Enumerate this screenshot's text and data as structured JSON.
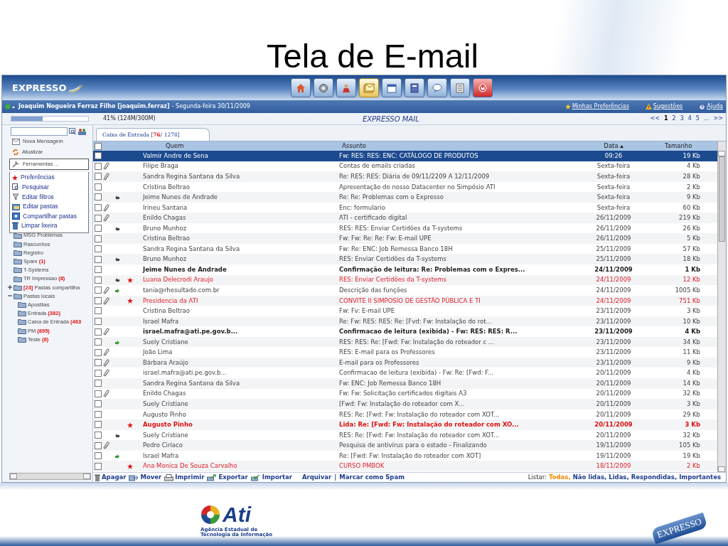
{
  "slide": {
    "title": "Tela de E-mail",
    "footer_logo": {
      "text": "Ati",
      "caption": "Agência Estadual de Tecnologia da Informação"
    },
    "footer_product": "EXPRESSO"
  },
  "app": {
    "logo": "EXPRESSO",
    "toolbar": [
      {
        "selected": false
      },
      {
        "selected": false
      },
      {
        "selected": false
      },
      {
        "selected": true
      },
      {
        "selected": false
      },
      {
        "selected": false
      },
      {
        "selected": false
      },
      {
        "selected": false
      },
      {
        "selected": false
      }
    ],
    "user": "Joaquim Nogueira Ferraz Filho [joaquim.ferraz]",
    "date": "- Segunda-feira 30/11/2009",
    "top_links": [
      "Minhas Preferências",
      "Sugestões",
      "Ajuda"
    ],
    "quota": {
      "level": 0.41,
      "reading": "41% (124M/300M)"
    },
    "module_title": "EXPRESSO MAIL",
    "pagination": [
      {
        "label": "<<",
        "selected": false
      },
      {
        "label": "1",
        "selected": true
      },
      {
        "label": "2",
        "selected": false
      },
      {
        "label": "3",
        "selected": false
      },
      {
        "label": "4",
        "selected": false
      },
      {
        "label": "5",
        "selected": false
      },
      {
        "label": "...",
        "selected": false
      },
      {
        "label": ">>",
        "selected": false
      }
    ],
    "sidebar": {
      "actions": [
        {
          "label": "Nova Mensagem"
        },
        {
          "label": "Atualizar"
        },
        {
          "label": "Ferramentas ...",
          "expanded": true,
          "menu": [
            "Preferências",
            "Pesquisar",
            "Editar filtros",
            "Editar pastas",
            "Compartilhar pastas",
            "Limpar lixeira"
          ]
        }
      ],
      "folders": [
        {
          "name": "MSG Problemas"
        },
        {
          "name": "Rascunhos"
        },
        {
          "name": "Registro"
        },
        {
          "name": "Spam",
          "count": "(1)"
        },
        {
          "name": "T-Systems"
        },
        {
          "name": "TR Impressao",
          "count": "(8)"
        },
        {
          "prefix": "[23]",
          "name": "Pastas compartilha",
          "expanded": false
        },
        {
          "name": "Pastas locais",
          "expanded": true,
          "children": [
            {
              "name": "Apostilas"
            },
            {
              "name": "Entrada",
              "count": "(382)"
            },
            {
              "name": "Caixa de Entrada",
              "count": "(463"
            },
            {
              "name": "PM",
              "count": "(895)"
            },
            {
              "name": "Teste",
              "count": "(8)"
            }
          ]
        }
      ]
    },
    "tab": {
      "selected": true,
      "label_parts": [
        {
          "text": "Caixa de Entrada [",
          "highlight": false
        },
        {
          "text": "76",
          "highlight": true
        },
        {
          "text": " / 1278]",
          "highlight": false
        }
      ]
    },
    "select_all": {
      "checked": false
    },
    "columns": [
      {
        "label": "Quem",
        "sorted": false
      },
      {
        "label": "Assunto",
        "sorted": false
      },
      {
        "label": "Data",
        "sorted": true
      },
      {
        "label": "Tamanho",
        "sorted": false
      }
    ],
    "rows": [
      {
        "from": "Valmir Andre de Sena",
        "subject": "Fw: RES: RES: ENC: CATÁLOGO DE PRODUTOS",
        "date": "09:26",
        "size": "19 Kb",
        "attachment": false,
        "kind": "plain",
        "important": false,
        "unread": false,
        "selected": true,
        "checked": false
      },
      {
        "from": "Filipe Braga",
        "subject": "Contas de emails criadas",
        "date": "Sexta-feira",
        "size": "4 Kb",
        "attachment": true,
        "kind": "plain",
        "important": false,
        "unread": false,
        "selected": false,
        "checked": false
      },
      {
        "from": "Sandra Regina Santana da Silva",
        "subject": "Re: RES: RES: Diária de 09/11/2209 A 12/11/2009",
        "date": "Sexta-feira",
        "size": "28 Kb",
        "attachment": true,
        "kind": "plain",
        "important": false,
        "unread": false,
        "selected": false,
        "checked": false
      },
      {
        "from": "Cristina Beltrao",
        "subject": "Apresentação do nosso Datacenter no Simpósio ATI",
        "date": "Sexta-feira",
        "size": "2 Kb",
        "attachment": false,
        "kind": "plain",
        "important": false,
        "unread": false,
        "selected": false,
        "checked": false
      },
      {
        "from": "Jeime Nunes de Andrade",
        "subject": "Re: Re: Problemas com o Expresso",
        "date": "Sexta-feira",
        "size": "9 Kb",
        "attachment": false,
        "kind": "replied",
        "important": false,
        "unread": false,
        "selected": false,
        "checked": false
      },
      {
        "from": "Irineu Santana",
        "subject": "Enc: formulario",
        "date": "Sexta-feira",
        "size": "60 Kb",
        "attachment": true,
        "kind": "plain",
        "important": false,
        "unread": false,
        "selected": false,
        "checked": false
      },
      {
        "from": "Enildo Chagas",
        "subject": "ATI - certificado digital",
        "date": "26/11/2009",
        "size": "219 Kb",
        "attachment": true,
        "kind": "plain",
        "important": false,
        "unread": false,
        "selected": false,
        "checked": false
      },
      {
        "from": "Bruno Munhoz",
        "subject": "RES: RES: Enviar Certidões da T-systems",
        "date": "26/11/2009",
        "size": "26 Kb",
        "attachment": false,
        "kind": "replied",
        "important": false,
        "unread": false,
        "selected": false,
        "checked": false
      },
      {
        "from": "Cristina Beltrao",
        "subject": "Fw: Fw: Re: Re: Fw: E-mail UPE",
        "date": "26/11/2009",
        "size": "5 Kb",
        "attachment": false,
        "kind": "plain",
        "important": false,
        "unread": false,
        "selected": false,
        "checked": false
      },
      {
        "from": "Sandra Regina Santana da Silva",
        "subject": "Fw: Re: ENC: Job Remessa Banco 18H",
        "date": "25/11/2009",
        "size": "57 Kb",
        "attachment": false,
        "kind": "plain",
        "important": false,
        "unread": false,
        "selected": false,
        "checked": false
      },
      {
        "from": "Bruno Munhoz",
        "subject": "RES: Enviar Certidões da T-systems",
        "date": "25/11/2009",
        "size": "18 Kb",
        "attachment": false,
        "kind": "replied",
        "important": false,
        "unread": false,
        "selected": false,
        "checked": false
      },
      {
        "from": "Jeime Nunes de Andrade",
        "subject": "Confirmação de leitura: Re: Problemas com o Expres...",
        "date": "24/11/2009",
        "size": "1 Kb",
        "attachment": false,
        "kind": "plain",
        "important": false,
        "unread": true,
        "selected": false,
        "checked": false
      },
      {
        "from": "Luana Delecrodi Araujo",
        "subject": "RES: Enviar Certidões da T-systems",
        "date": "24/11/2009",
        "size": "12 Kb",
        "attachment": false,
        "kind": "replied",
        "important": true,
        "unread": false,
        "selected": false,
        "checked": false
      },
      {
        "from": "tania@rhesultado.com.br",
        "subject": "Descrição das funções",
        "date": "24/11/2009",
        "size": "1005 Kb",
        "attachment": true,
        "kind": "forwarded",
        "important": false,
        "unread": false,
        "selected": false,
        "checked": false
      },
      {
        "from": "Presidencia da ATI",
        "subject": "CONVITE II SIMPOSIO DE GESTÃO PÚBLICA E TI",
        "date": "24/11/2009",
        "size": "751 Kb",
        "attachment": true,
        "kind": "plain",
        "important": true,
        "unread": false,
        "selected": false,
        "checked": false
      },
      {
        "from": "Cristina Beltrao",
        "subject": "Fw: Fv: E-mail UPE",
        "date": "23/11/2009",
        "size": "3 Kb",
        "attachment": false,
        "kind": "plain",
        "important": false,
        "unread": false,
        "selected": false,
        "checked": false
      },
      {
        "from": "Israel Mafra",
        "subject": "Re: Fw: RES: RES: Re: [Fvd: Fw: Instalação do rot...",
        "date": "23/11/2009",
        "size": "10 Kb",
        "attachment": false,
        "kind": "plain",
        "important": false,
        "unread": false,
        "selected": false,
        "checked": false
      },
      {
        "from": "israel.mafra@ati.pe.gov.b...",
        "subject": "Confirmacao de leitura (exibida) - Fw: RES: RES: R...",
        "date": "23/11/2009",
        "size": "4 Kb",
        "attachment": true,
        "kind": "plain",
        "important": false,
        "unread": true,
        "selected": false,
        "checked": false
      },
      {
        "from": "Suely Cristiane",
        "subject": "RES: RES: Re: [Fwd: Fw: Instalação do roteador c ...",
        "date": "23/11/2009",
        "size": "34 Kb",
        "attachment": false,
        "kind": "forwarded",
        "important": false,
        "unread": false,
        "selected": false,
        "checked": false
      },
      {
        "from": "João Lima",
        "subject": "RES: E-mail para os Professores",
        "date": "23/11/2009",
        "size": "11 Kb",
        "attachment": true,
        "kind": "plain",
        "important": false,
        "unread": false,
        "selected": false,
        "checked": false
      },
      {
        "from": "Bárbara Araújo",
        "subject": "E-mail para os Professores",
        "date": "23/11/2009",
        "size": "9 Kb",
        "attachment": true,
        "kind": "plain",
        "important": false,
        "unread": false,
        "selected": false,
        "checked": false
      },
      {
        "from": "israel.mafra@ati.pe.gov.b...",
        "subject": "Confirmacao de leitura (exibida) - Fw: Re: [Fwd: F...",
        "date": "20/11/2009",
        "size": "4 Kb",
        "attachment": true,
        "kind": "plain",
        "important": false,
        "unread": false,
        "selected": false,
        "checked": false
      },
      {
        "from": "Sandra Regina Santana da Silva",
        "subject": "Fw: ENC: Job Remessa Banco 18H",
        "date": "20/11/2009",
        "size": "14 Kb",
        "attachment": false,
        "kind": "plain",
        "important": false,
        "unread": false,
        "selected": false,
        "checked": false
      },
      {
        "from": "Enildo Chagas",
        "subject": "Fw: Fw: Solicitação certificados digitais A3",
        "date": "20/11/2009",
        "size": "32 Kb",
        "attachment": true,
        "kind": "plain",
        "important": false,
        "unread": false,
        "selected": false,
        "checked": false
      },
      {
        "from": "Suely Cristiane",
        "subject": "[Fwd: Fw: Instalação do roteador com X...",
        "date": "20/11/2009",
        "size": "3 Kb",
        "attachment": false,
        "kind": "plain",
        "important": false,
        "unread": false,
        "selected": false,
        "checked": false
      },
      {
        "from": "Augusto Pinho",
        "subject": "RES: Re: [Fwd: Fw: Instalação do roteador com XOT...",
        "date": "20/11/2009",
        "size": "29 Kb",
        "attachment": false,
        "kind": "plain",
        "important": false,
        "unread": false,
        "selected": false,
        "checked": false
      },
      {
        "from": "Augusto Pinho",
        "subject": "Lida: Re: [Fwd: Fw: Instalação do roteador com XO...",
        "date": "20/11/2009",
        "size": "3 Kb",
        "attachment": false,
        "kind": "plain",
        "important": true,
        "unread": true,
        "selected": false,
        "checked": false
      },
      {
        "from": "Suely Cristiane",
        "subject": "RES: Re: [Fwd: Fw: Instalação do roteador com XOT...",
        "date": "20/11/2009",
        "size": "32 Kb",
        "attachment": false,
        "kind": "replied",
        "important": false,
        "unread": false,
        "selected": false,
        "checked": false
      },
      {
        "from": "Pedro Ciríaco",
        "subject": "Pesquisa de antivírus para o estado - Finalizando",
        "date": "19/11/2009",
        "size": "105 Kb",
        "attachment": true,
        "kind": "plain",
        "important": false,
        "unread": false,
        "selected": false,
        "checked": false
      },
      {
        "from": "Israel Mafra",
        "subject": "Re: [Fwd: Fw: Instalação do roteador com XOT]",
        "date": "19/11/2009",
        "size": "19 Kb",
        "attachment": false,
        "kind": "forwarded",
        "important": false,
        "unread": false,
        "selected": false,
        "checked": false
      },
      {
        "from": "Ana Monica De Souza Carvalho",
        "subject": "CURSO PMBOK",
        "date": "18/11/2009",
        "size": "2 Kb",
        "attachment": false,
        "kind": "plain",
        "important": true,
        "unread": false,
        "selected": false,
        "checked": false
      }
    ],
    "actions": [
      {
        "kind": "icon-link",
        "label": "Apagar"
      },
      {
        "kind": "icon-link",
        "label": "Mover"
      },
      {
        "kind": "icon-link",
        "label": "Imprimir"
      },
      {
        "kind": "icon-link",
        "label": "Exportar"
      },
      {
        "kind": "icon-link",
        "label": "Importar"
      },
      {
        "kind": "link",
        "label": "Arquivar"
      },
      {
        "kind": "separator",
        "label": "|"
      },
      {
        "kind": "link",
        "label": "Marcar como Spam"
      }
    ],
    "list_filter": {
      "label": "Listar:",
      "separator": ",",
      "options": [
        {
          "label": "Todas",
          "selected": true
        },
        {
          "label": "Não lidas",
          "selected": false
        },
        {
          "label": "Lidas",
          "selected": false
        },
        {
          "label": "Respondidas",
          "selected": false
        },
        {
          "label": "Importantes",
          "selected": false
        }
      ]
    }
  }
}
